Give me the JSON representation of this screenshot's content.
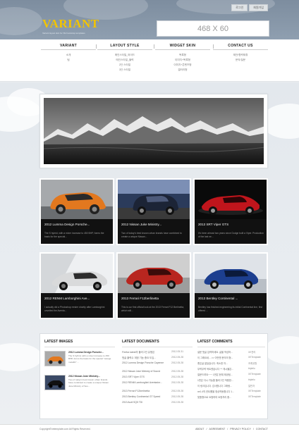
{
  "header": {
    "top_links": [
      "로그인",
      "회원가입"
    ],
    "logo": "VARIANT",
    "logo_sub": "Variant layout skin for XE bootstrap templates",
    "banner": "468 X 60"
  },
  "nav": [
    {
      "label": "VARIANT",
      "items": [
        "소개",
        "팀"
      ]
    },
    {
      "label": "LAYOUT STYLE",
      "items": [
        "메인스타일_와이드",
        "메인스타일_블럭",
        "2단 스타일",
        "3단 스타일"
      ]
    },
    {
      "label": "WIDGET SKIN",
      "items": [
        "목록형",
        "이미지+목록형",
        "이미지+콘텐츠형",
        "갤러리형"
      ]
    },
    {
      "label": "CONTACT US",
      "items": [
        "제안/협력제휴",
        "문의/질문"
      ]
    }
  ],
  "cards": [
    {
      "title": "2012 Lumma Design Porsche...",
      "desc": "The S hybrid, with a mixer increase to 450 BHP, forms the basis for the special...",
      "color": "#e2781f"
    },
    {
      "title": "2012 Nissan Juke Ministry...",
      "desc": "Two of today's best known urban brands have combined to create a unique Nissan...",
      "color": "#1c2436"
    },
    {
      "title": "2013 SRT Viper GTS",
      "desc": "It's been almost two years since Dodge built a Viper. Production of the last ne...",
      "color": "#c0151c"
    },
    {
      "title": "2012 RENM Lamborghini Ave...",
      "desc": "I actually did a Photoshop render shortly after Lamborghini unveiled the Aventa...",
      "color": "#d9dadb"
    },
    {
      "title": "2013 Ferrari F12berlinetta",
      "desc": "This is our first official look at the 2013 Ferrari F12 Berlinetta, which will...",
      "color": "#b8261f"
    },
    {
      "title": "2013 Bentley Continental ...",
      "desc": "Bentley has finished engineering its initial Continental line, first offered ...",
      "color": "#1d3f8f"
    }
  ],
  "latest_images": {
    "heading": "LATEST IMAGES",
    "items": [
      {
        "title": "2012 Lumma Design Porsche...",
        "desc": "The S hybrid, with a mixer increase to 450 BHP, forms the basis for the special \"orange metallic\" ...",
        "color": "#e2781f"
      },
      {
        "title": "2012 Nissan Juke Ministry...",
        "desc": "Two of today's best known urban brands have combined to create a unique Nissan Juke Ministry of Sou...",
        "color": "#1c2436"
      }
    ]
  },
  "latest_documents": {
    "heading": "LATEST DOCUMENTS",
    "items": [
      {
        "title": "Firefox latest의 플러그인 유형은",
        "date": "2012.05.31"
      },
      {
        "title": "댓글 출력수 계정 기능 중요 도입...",
        "date": "2012.05.28"
      },
      {
        "title": "2012 Lumma Design Porsche Cayenne",
        "date": "2012.05.28"
      },
      {
        "title": "2012 Nissan Juke Ministry of Sound",
        "date": "2012.05.28"
      },
      {
        "title": "2013 SRT Viper GTS",
        "date": "2012.05.28"
      },
      {
        "title": "2012 RENM Lamborghini Aventador...",
        "date": "2012.05.28"
      },
      {
        "title": "2013 Ferrari F12berlinetta",
        "date": "2012.05.28"
      },
      {
        "title": "2013 Bentley Continental GT Speed",
        "date": "2012.05.28"
      },
      {
        "title": "2013 Audi SQ5 TDI",
        "date": "2012.05.28"
      }
    ]
  },
  "latest_comments": {
    "heading": "LATEST COMMENTS",
    "items": [
      {
        "text": "설문 댓글 입력하세요. 글을 작성하...",
        "user": "XE관리"
      },
      {
        "text": "이 그래요네... >> 이번엔 문의의 형...",
        "user": "XETemplate"
      },
      {
        "text": "좋은글 잘읽습니다. 최소한 자...",
        "user": "초록공원"
      },
      {
        "text": "무럭무럭 싹트렸습니다 ^^ 게시물은...",
        "user": "triplelo"
      },
      {
        "text": "질문드려요~~~ 1번은 현재 제공됩...",
        "user": "XETemplate"
      },
      {
        "text": "1번은 다시 가능할 플러그인 적용한...",
        "user": "triplelo"
      },
      {
        "text": "이 링크입니다. 감사합니다 그래랑...",
        "user": "일반자"
      },
      {
        "text": "xe1.4의 컨트롤을 정상작동합니다 1...",
        "user": "XETemplate"
      },
      {
        "text": "맞춤형으로 요청하여 요청처리 중...",
        "user": "XETemplate"
      }
    ]
  },
  "footer": {
    "copyright": "Copyright©xetemplate.com All Rights Reserved.",
    "links": [
      "ABOUT",
      "AGREEMENT",
      "PRIVACY POLICY",
      "CONTACT"
    ]
  }
}
